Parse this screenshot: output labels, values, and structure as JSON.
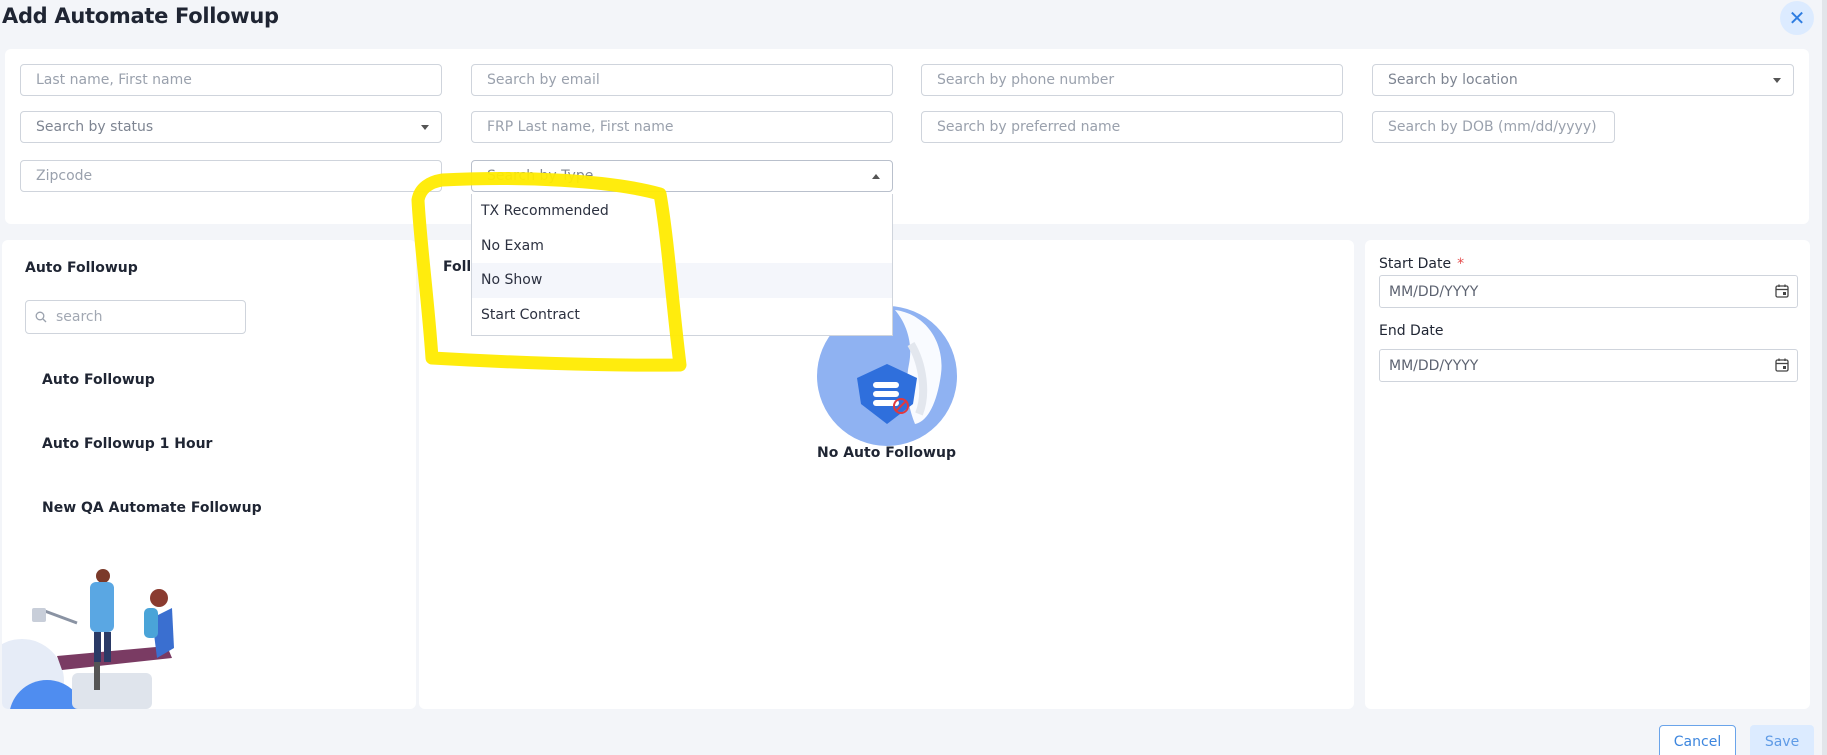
{
  "page": {
    "title": "Add Automate Followup"
  },
  "filters": {
    "name_placeholder": "Last name, First name",
    "email_placeholder": "Search by email",
    "phone_placeholder": "Search by phone number",
    "location_label": "Search by location",
    "status_label": "Search by status",
    "frp_placeholder": "FRP Last name, First name",
    "preferred_placeholder": "Search by preferred name",
    "dob_placeholder": "Search by DOB (mm/dd/yyyy)",
    "zipcode_placeholder": "Zipcode",
    "type_label": "Search by Type"
  },
  "type_dropdown": {
    "options": [
      "TX Recommended",
      "No Exam",
      "No Show",
      "Start Contract"
    ]
  },
  "left_panel": {
    "title": "Auto Followup",
    "search_placeholder": "search",
    "items": [
      "Auto Followup",
      "Auto Followup 1 Hour",
      "New QA Automate Followup"
    ]
  },
  "middle_panel": {
    "title": "Follo",
    "empty_text": "No Auto Followup"
  },
  "right_panel": {
    "start_label": "Start Date",
    "required_mark": "*",
    "start_placeholder": "MM/DD/YYYY",
    "end_label": "End Date",
    "end_placeholder": "MM/DD/YYYY"
  },
  "footer": {
    "cancel_label": "Cancel",
    "save_label": "Save"
  },
  "colors": {
    "accent": "#2f7de1",
    "highlight": "#ffeb00",
    "illustration_blue": "#8fb2f2"
  },
  "icons": {
    "close": "close-icon",
    "search": "search-icon",
    "calendar": "calendar-icon",
    "empty_state": "database-blocked-icon"
  }
}
